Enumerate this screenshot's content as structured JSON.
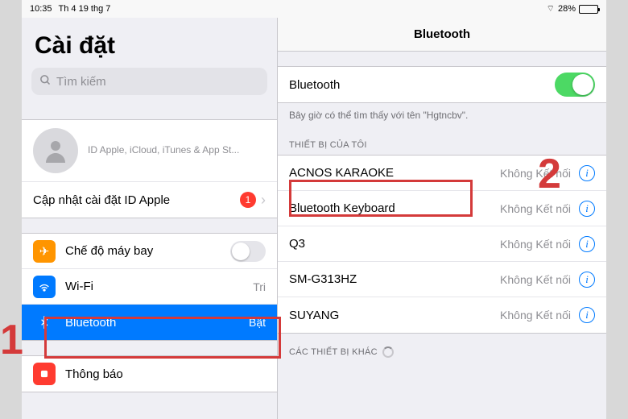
{
  "statusbar": {
    "time": "10:35",
    "date": "Th 4 19 thg 7",
    "battery_pct": "28%"
  },
  "sidebar": {
    "title": "Cài đặt",
    "search_placeholder": "Tìm kiếm",
    "profile_sub": "ID Apple, iCloud, iTunes & App St...",
    "update_label": "Cập nhật cài đặt ID Apple",
    "update_badge": "1",
    "items": {
      "airplane": {
        "label": "Chế độ máy bay"
      },
      "wifi": {
        "label": "Wi-Fi",
        "value": "Tri"
      },
      "bluetooth": {
        "label": "Bluetooth",
        "value": "Bật"
      },
      "notifications": {
        "label": "Thông báo"
      }
    }
  },
  "detail": {
    "header": "Bluetooth",
    "toggle_label": "Bluetooth",
    "discoverable_text": "Bây giờ có thể tìm thấy với tên \"Hgtncbv\".",
    "my_devices_header": "THIẾT BỊ CỦA TÔI",
    "other_devices_header": "CÁC THIẾT BỊ KHÁC",
    "devices": [
      {
        "name": "ACNOS KARAOKE",
        "status": "Không Kết nối"
      },
      {
        "name": "Bluetooth Keyboard",
        "status": "Không Kết nối"
      },
      {
        "name": "Q3",
        "status": "Không Kết nối"
      },
      {
        "name": "SM-G313HZ",
        "status": "Không Kết nối"
      },
      {
        "name": "SUYANG",
        "status": "Không Kết nối"
      }
    ]
  },
  "callouts": {
    "one": "1",
    "two": "2"
  }
}
